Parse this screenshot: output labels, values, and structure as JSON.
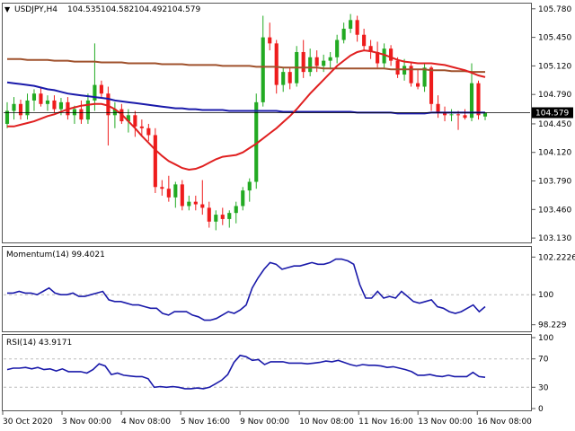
{
  "chart_data": {
    "type": "candlestick",
    "symbol": "USDJPY,H4",
    "ohlc_header": {
      "open": "104.535",
      "high": "104.582",
      "low": "104.492",
      "close": "104.579"
    },
    "current_price_label": "104.579",
    "colors": {
      "up": "#22aa22",
      "down": "#ee1c1c",
      "ma_fast": "#e02020",
      "ma_mid": "#1a1aaa",
      "ma_slow": "#a0522d",
      "momentum": "#1a1aaa",
      "rsi": "#1a1aaa",
      "grid": "#bbbbbb",
      "border": "#555555"
    },
    "price_axis": {
      "ticks": [
        "105.780",
        "105.450",
        "105.120",
        "104.790",
        "104.450",
        "104.120",
        "103.790",
        "103.460",
        "103.130"
      ],
      "ylim": [
        103.1,
        105.83
      ]
    },
    "x_labels": [
      "30 Oct 2020",
      "3 Nov 00:00",
      "4 Nov 08:00",
      "5 Nov 16:00",
      "9 Nov 00:00",
      "10 Nov 08:00",
      "11 Nov 16:00",
      "13 Nov 00:00",
      "16 Nov 08:00"
    ],
    "candles": [
      {
        "o": 104.45,
        "h": 104.7,
        "l": 104.4,
        "c": 104.6
      },
      {
        "o": 104.6,
        "h": 104.76,
        "l": 104.5,
        "c": 104.68
      },
      {
        "o": 104.68,
        "h": 104.73,
        "l": 104.5,
        "c": 104.55
      },
      {
        "o": 104.55,
        "h": 104.8,
        "l": 104.5,
        "c": 104.72
      },
      {
        "o": 104.72,
        "h": 104.85,
        "l": 104.6,
        "c": 104.8
      },
      {
        "o": 104.8,
        "h": 104.88,
        "l": 104.65,
        "c": 104.68
      },
      {
        "o": 104.68,
        "h": 104.78,
        "l": 104.6,
        "c": 104.72
      },
      {
        "o": 104.72,
        "h": 104.78,
        "l": 104.58,
        "c": 104.62
      },
      {
        "o": 104.62,
        "h": 104.75,
        "l": 104.55,
        "c": 104.7
      },
      {
        "o": 104.7,
        "h": 104.76,
        "l": 104.5,
        "c": 104.55
      },
      {
        "o": 104.55,
        "h": 104.66,
        "l": 104.45,
        "c": 104.62
      },
      {
        "o": 104.62,
        "h": 104.72,
        "l": 104.45,
        "c": 104.5
      },
      {
        "o": 104.5,
        "h": 104.8,
        "l": 104.45,
        "c": 104.72
      },
      {
        "o": 104.72,
        "h": 105.38,
        "l": 104.6,
        "c": 104.9
      },
      {
        "o": 104.9,
        "h": 104.95,
        "l": 104.75,
        "c": 104.8
      },
      {
        "o": 104.8,
        "h": 104.88,
        "l": 104.2,
        "c": 104.55
      },
      {
        "o": 104.55,
        "h": 104.7,
        "l": 104.4,
        "c": 104.62
      },
      {
        "o": 104.62,
        "h": 104.68,
        "l": 104.45,
        "c": 104.48
      },
      {
        "o": 104.48,
        "h": 104.62,
        "l": 104.35,
        "c": 104.55
      },
      {
        "o": 104.55,
        "h": 104.6,
        "l": 104.3,
        "c": 104.42
      },
      {
        "o": 104.42,
        "h": 104.5,
        "l": 104.3,
        "c": 104.4
      },
      {
        "o": 104.4,
        "h": 104.45,
        "l": 104.25,
        "c": 104.32
      },
      {
        "o": 104.32,
        "h": 104.4,
        "l": 103.65,
        "c": 103.72
      },
      {
        "o": 103.72,
        "h": 103.8,
        "l": 103.62,
        "c": 103.7
      },
      {
        "o": 103.7,
        "h": 103.85,
        "l": 103.55,
        "c": 103.6
      },
      {
        "o": 103.6,
        "h": 103.78,
        "l": 103.48,
        "c": 103.75
      },
      {
        "o": 103.75,
        "h": 103.8,
        "l": 103.45,
        "c": 103.5
      },
      {
        "o": 103.5,
        "h": 103.62,
        "l": 103.45,
        "c": 103.55
      },
      {
        "o": 103.55,
        "h": 103.62,
        "l": 103.45,
        "c": 103.52
      },
      {
        "o": 103.52,
        "h": 103.8,
        "l": 103.4,
        "c": 103.48
      },
      {
        "o": 103.48,
        "h": 103.55,
        "l": 103.25,
        "c": 103.32
      },
      {
        "o": 103.32,
        "h": 103.45,
        "l": 103.22,
        "c": 103.4
      },
      {
        "o": 103.4,
        "h": 103.48,
        "l": 103.28,
        "c": 103.35
      },
      {
        "o": 103.35,
        "h": 103.45,
        "l": 103.25,
        "c": 103.42
      },
      {
        "o": 103.42,
        "h": 103.55,
        "l": 103.3,
        "c": 103.5
      },
      {
        "o": 103.5,
        "h": 103.72,
        "l": 103.45,
        "c": 103.68
      },
      {
        "o": 103.68,
        "h": 103.82,
        "l": 103.55,
        "c": 103.78
      },
      {
        "o": 103.78,
        "h": 104.8,
        "l": 103.7,
        "c": 104.7
      },
      {
        "o": 104.7,
        "h": 105.7,
        "l": 104.65,
        "c": 105.45
      },
      {
        "o": 105.45,
        "h": 105.62,
        "l": 105.3,
        "c": 105.38
      },
      {
        "o": 105.38,
        "h": 105.42,
        "l": 104.8,
        "c": 104.9
      },
      {
        "o": 104.9,
        "h": 105.1,
        "l": 104.82,
        "c": 105.05
      },
      {
        "o": 105.05,
        "h": 105.1,
        "l": 104.85,
        "c": 104.92
      },
      {
        "o": 104.92,
        "h": 105.35,
        "l": 104.88,
        "c": 105.28
      },
      {
        "o": 105.28,
        "h": 105.42,
        "l": 104.98,
        "c": 105.05
      },
      {
        "o": 105.05,
        "h": 105.32,
        "l": 105.0,
        "c": 105.22
      },
      {
        "o": 105.22,
        "h": 105.3,
        "l": 105.05,
        "c": 105.12
      },
      {
        "o": 105.12,
        "h": 105.25,
        "l": 105.05,
        "c": 105.18
      },
      {
        "o": 105.18,
        "h": 105.28,
        "l": 105.08,
        "c": 105.22
      },
      {
        "o": 105.22,
        "h": 105.48,
        "l": 105.15,
        "c": 105.42
      },
      {
        "o": 105.42,
        "h": 105.62,
        "l": 105.38,
        "c": 105.55
      },
      {
        "o": 105.55,
        "h": 105.72,
        "l": 105.5,
        "c": 105.65
      },
      {
        "o": 105.65,
        "h": 105.7,
        "l": 105.4,
        "c": 105.48
      },
      {
        "o": 105.48,
        "h": 105.55,
        "l": 105.3,
        "c": 105.35
      },
      {
        "o": 105.35,
        "h": 105.42,
        "l": 105.2,
        "c": 105.28
      },
      {
        "o": 105.28,
        "h": 105.4,
        "l": 105.1,
        "c": 105.15
      },
      {
        "o": 105.15,
        "h": 105.38,
        "l": 105.1,
        "c": 105.32
      },
      {
        "o": 105.32,
        "h": 105.36,
        "l": 105.12,
        "c": 105.18
      },
      {
        "o": 105.18,
        "h": 105.22,
        "l": 104.98,
        "c": 105.02
      },
      {
        "o": 105.02,
        "h": 105.2,
        "l": 104.95,
        "c": 105.12
      },
      {
        "o": 105.12,
        "h": 105.15,
        "l": 104.88,
        "c": 104.92
      },
      {
        "o": 104.92,
        "h": 105.08,
        "l": 104.85,
        "c": 104.88
      },
      {
        "o": 104.88,
        "h": 105.15,
        "l": 104.82,
        "c": 105.1
      },
      {
        "o": 105.1,
        "h": 105.12,
        "l": 104.6,
        "c": 104.68
      },
      {
        "o": 104.68,
        "h": 104.78,
        "l": 104.52,
        "c": 104.58
      },
      {
        "o": 104.58,
        "h": 104.65,
        "l": 104.48,
        "c": 104.55
      },
      {
        "o": 104.55,
        "h": 104.62,
        "l": 104.48,
        "c": 104.56
      },
      {
        "o": 104.56,
        "h": 104.6,
        "l": 104.38,
        "c": 104.55
      },
      {
        "o": 104.55,
        "h": 104.62,
        "l": 104.5,
        "c": 104.52
      },
      {
        "o": 104.52,
        "h": 105.15,
        "l": 104.48,
        "c": 104.92
      },
      {
        "o": 104.92,
        "h": 104.95,
        "l": 104.5,
        "c": 104.55
      },
      {
        "o": 104.535,
        "h": 104.582,
        "l": 104.492,
        "c": 104.579
      }
    ],
    "ma_fast": [
      104.42,
      104.42,
      104.44,
      104.46,
      104.48,
      104.51,
      104.54,
      104.56,
      104.59,
      104.62,
      104.64,
      104.66,
      104.67,
      104.68,
      104.68,
      104.66,
      104.62,
      104.56,
      104.48,
      104.4,
      104.31,
      104.23,
      104.15,
      104.08,
      104.02,
      103.98,
      103.94,
      103.92,
      103.93,
      103.96,
      104.0,
      104.04,
      104.07,
      104.08,
      104.09,
      104.12,
      104.17,
      104.22,
      104.28,
      104.34,
      104.4,
      104.47,
      104.54,
      104.62,
      104.71,
      104.8,
      104.88,
      104.96,
      105.04,
      105.12,
      105.18,
      105.24,
      105.28,
      105.3,
      105.29,
      105.27,
      105.25,
      105.22,
      105.19,
      105.17,
      105.16,
      105.15,
      105.15,
      105.15,
      105.14,
      105.13,
      105.11,
      105.09,
      105.07,
      105.04,
      105.01,
      104.99
    ],
    "ma_mid": [
      104.93,
      104.92,
      104.91,
      104.9,
      104.89,
      104.87,
      104.85,
      104.84,
      104.82,
      104.8,
      104.79,
      104.78,
      104.77,
      104.76,
      104.75,
      104.74,
      104.72,
      104.71,
      104.7,
      104.69,
      104.68,
      104.67,
      104.66,
      104.65,
      104.64,
      104.63,
      104.63,
      104.62,
      104.62,
      104.61,
      104.61,
      104.61,
      104.61,
      104.6,
      104.6,
      104.6,
      104.6,
      104.6,
      104.6,
      104.6,
      104.6,
      104.59,
      104.59,
      104.59,
      104.59,
      104.59,
      104.59,
      104.59,
      104.59,
      104.59,
      104.59,
      104.59,
      104.58,
      104.58,
      104.58,
      104.58,
      104.58,
      104.58,
      104.57,
      104.57,
      104.57,
      104.57,
      104.57,
      104.58,
      104.58,
      104.58,
      104.58,
      104.58,
      104.58,
      104.58,
      104.58,
      104.58
    ],
    "ma_slow": [
      105.2,
      105.2,
      105.2,
      105.19,
      105.19,
      105.19,
      105.19,
      105.18,
      105.18,
      105.18,
      105.17,
      105.17,
      105.17,
      105.17,
      105.16,
      105.16,
      105.16,
      105.16,
      105.15,
      105.15,
      105.15,
      105.15,
      105.15,
      105.14,
      105.14,
      105.14,
      105.14,
      105.13,
      105.13,
      105.13,
      105.13,
      105.13,
      105.12,
      105.12,
      105.12,
      105.12,
      105.12,
      105.11,
      105.11,
      105.11,
      105.11,
      105.1,
      105.1,
      105.1,
      105.1,
      105.1,
      105.1,
      105.09,
      105.09,
      105.09,
      105.09,
      105.09,
      105.09,
      105.09,
      105.09,
      105.09,
      105.09,
      105.08,
      105.08,
      105.08,
      105.08,
      105.08,
      105.08,
      105.07,
      105.07,
      105.07,
      105.06,
      105.06,
      105.06,
      105.05,
      105.05,
      105.05
    ],
    "momentum": {
      "label": "Momentum(14) 99.4021",
      "ticks": [
        "102.2226",
        "100",
        "98.229"
      ],
      "ylim": [
        98.0,
        102.45
      ],
      "values": [
        100.1,
        100.1,
        100.2,
        100.1,
        100.1,
        100.0,
        100.2,
        100.4,
        100.1,
        100.0,
        100.0,
        100.1,
        99.9,
        99.9,
        100.0,
        100.1,
        100.2,
        99.7,
        99.6,
        99.6,
        99.5,
        99.4,
        99.4,
        99.3,
        99.2,
        99.2,
        98.9,
        98.8,
        99.0,
        99.0,
        99.0,
        98.8,
        98.7,
        98.5,
        98.5,
        98.6,
        98.8,
        99.0,
        98.9,
        99.1,
        99.4,
        100.4,
        101.0,
        101.5,
        101.9,
        101.8,
        101.5,
        101.6,
        101.7,
        101.7,
        101.8,
        101.9,
        101.8,
        101.8,
        101.9,
        102.1,
        102.1,
        102.0,
        101.8,
        100.6,
        99.8,
        99.8,
        100.2,
        99.8,
        99.9,
        99.8,
        100.2,
        99.9,
        99.6,
        99.5,
        99.6,
        99.7,
        99.3,
        99.2,
        99.0,
        98.9,
        99.0,
        99.2,
        99.4,
        99.0,
        99.3
      ]
    },
    "rsi": {
      "label": "RSI(14) 43.9171",
      "ticks": [
        "100",
        "70",
        "30",
        "0"
      ],
      "ylim": [
        0,
        100
      ],
      "values": [
        55,
        57,
        57,
        58,
        56,
        58,
        55,
        56,
        53,
        56,
        52,
        52,
        52,
        50,
        55,
        63,
        60,
        48,
        50,
        47,
        46,
        45,
        45,
        42,
        30,
        31,
        30,
        31,
        30,
        28,
        28,
        29,
        28,
        30,
        35,
        40,
        48,
        65,
        75,
        73,
        68,
        69,
        62,
        66,
        66,
        66,
        64,
        64,
        64,
        63,
        64,
        65,
        67,
        66,
        68,
        65,
        62,
        60,
        62,
        61,
        61,
        60,
        58,
        59,
        57,
        55,
        52,
        47,
        47,
        48,
        46,
        45,
        47,
        45,
        45,
        45,
        51,
        45,
        44
      ]
    }
  }
}
